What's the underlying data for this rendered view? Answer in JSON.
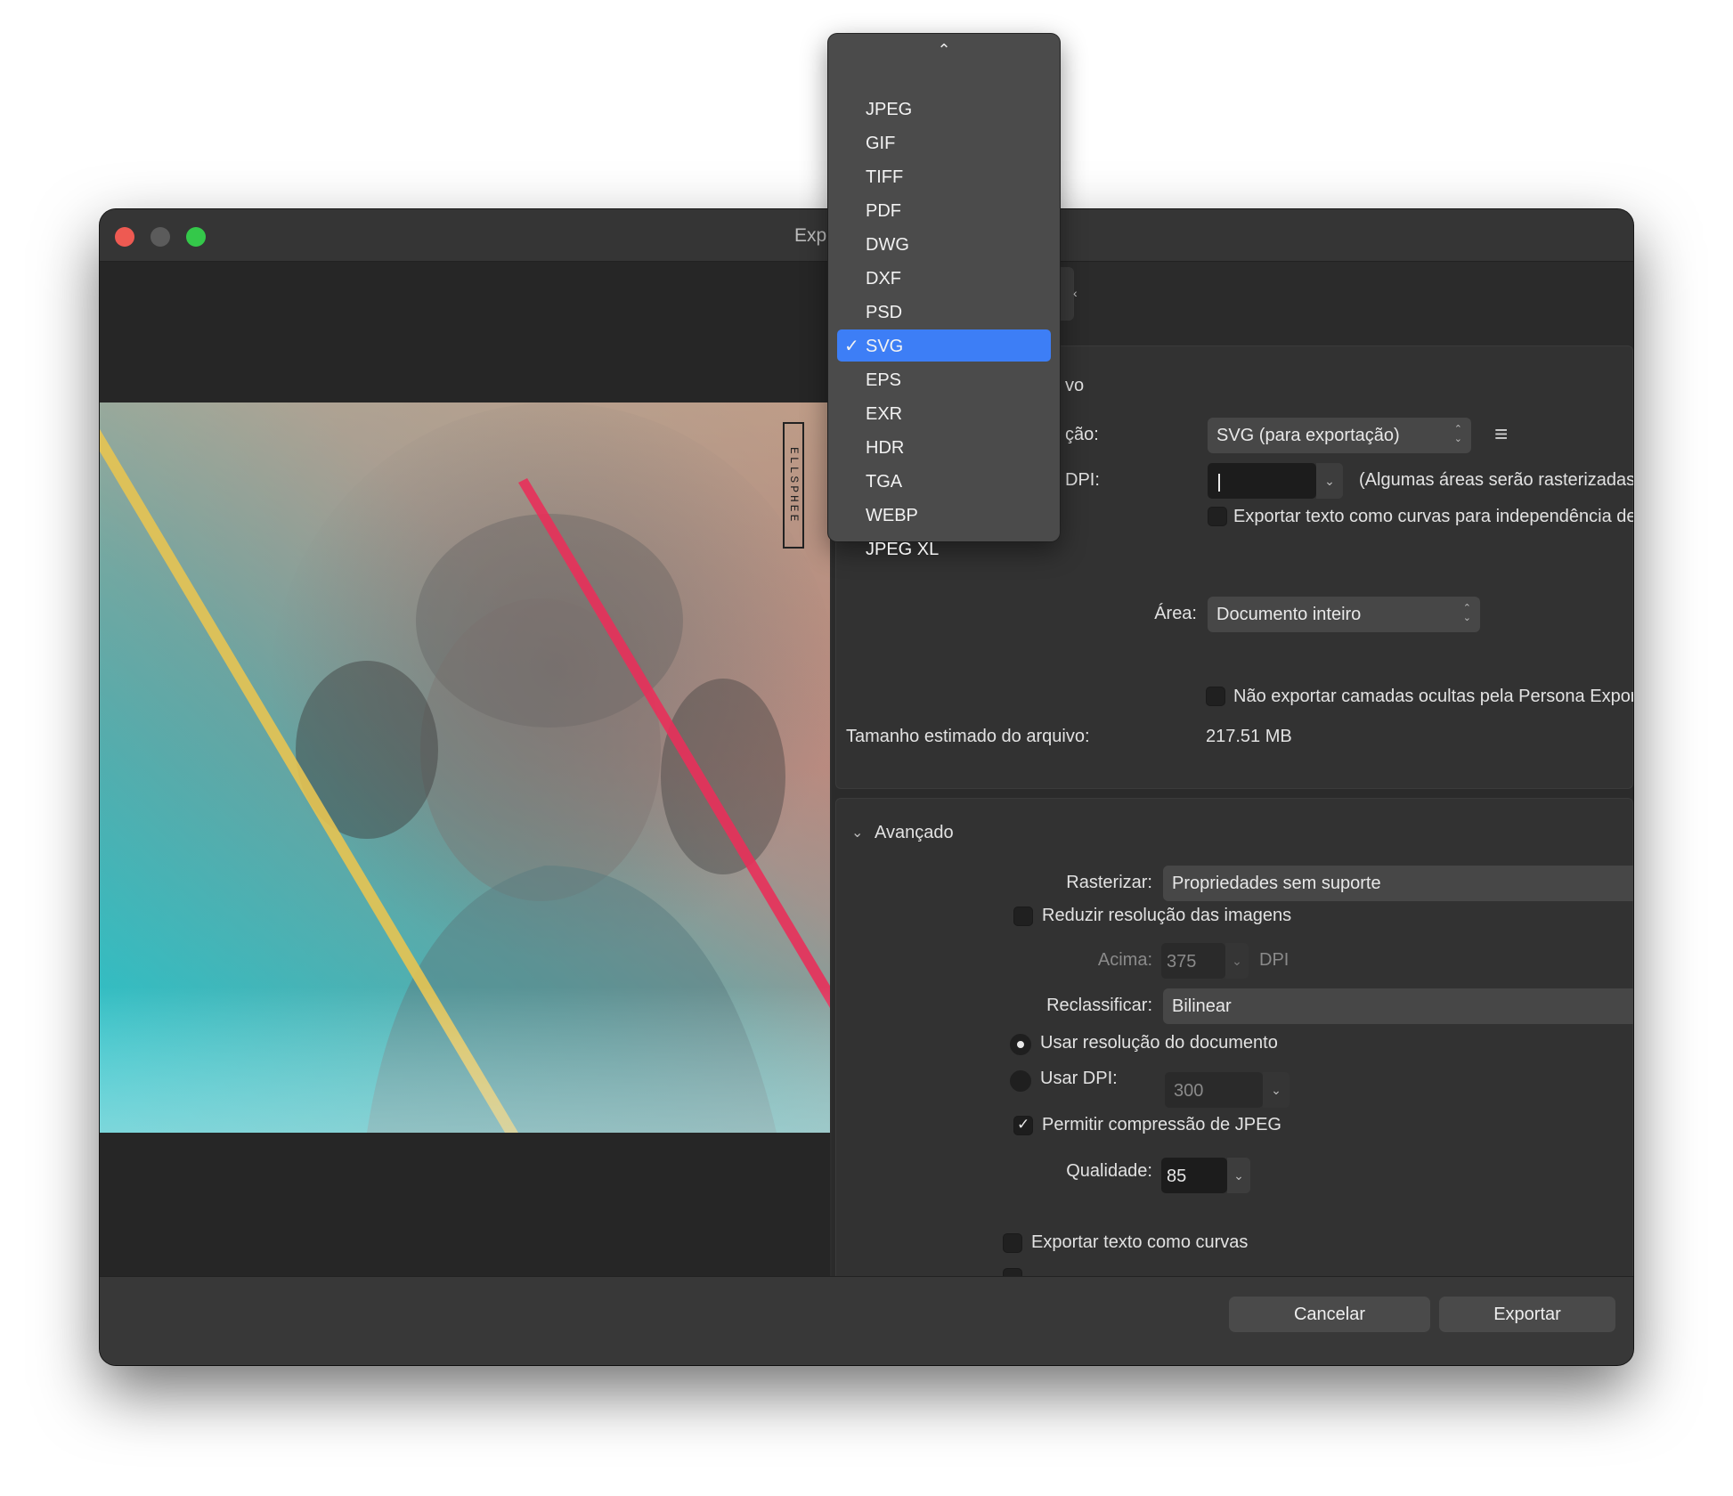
{
  "window": {
    "title": "Exp",
    "colors": {
      "close": "#ee5a52",
      "minimize": "#5b5b5b",
      "zoom": "#34c84a"
    }
  },
  "format_menu": {
    "scroll_up_icon": "chevron-up-icon",
    "items": [
      "JPEG",
      "GIF",
      "TIFF",
      "PDF",
      "DWG",
      "DXF",
      "PSD",
      "SVG",
      "EPS",
      "EXR",
      "HDR",
      "TGA",
      "WEBP",
      "JPEG XL"
    ],
    "selected": "SVG",
    "selected_color": "#3d7ef6"
  },
  "artwork": {
    "signature": "ELLSPHEE"
  },
  "file_section": {
    "header_fragment": "vo",
    "preset_label_fragment": "ção:",
    "preset_value": "SVG (para exportação)",
    "dpi_label_fragment": "DPI:",
    "dpi_value": "",
    "dpi_note": "(Algumas áreas serão rasterizadas)",
    "text_curves_label": "Exportar texto como curvas para independência de fonte",
    "area_label": "Área:",
    "area_value": "Documento inteiro",
    "hidden_layers_label": "Não exportar camadas ocultas pela Persona Exportar",
    "size_label": "Tamanho estimado do arquivo:",
    "size_value": "217.51 MB"
  },
  "advanced": {
    "header": "Avançado",
    "rasterize_label": "Rasterizar:",
    "rasterize_value": "Propriedades sem suporte",
    "downsample_label": "Reduzir resolução das imagens",
    "above_label": "Acima:",
    "above_value": "375",
    "above_unit": "DPI",
    "resample_label": "Reclassificar:",
    "resample_value": "Bilinear",
    "use_doc_res_label": "Usar resolução do documento",
    "use_dpi_label": "Usar DPI:",
    "use_dpi_value": "300",
    "jpeg_label": "Permitir compressão de JPEG",
    "jpeg_checked": true,
    "quality_label": "Qualidade:",
    "quality_value": "85",
    "export_curves_label": "Exportar texto como curvas"
  },
  "footer": {
    "cancel": "Cancelar",
    "export": "Exportar"
  }
}
